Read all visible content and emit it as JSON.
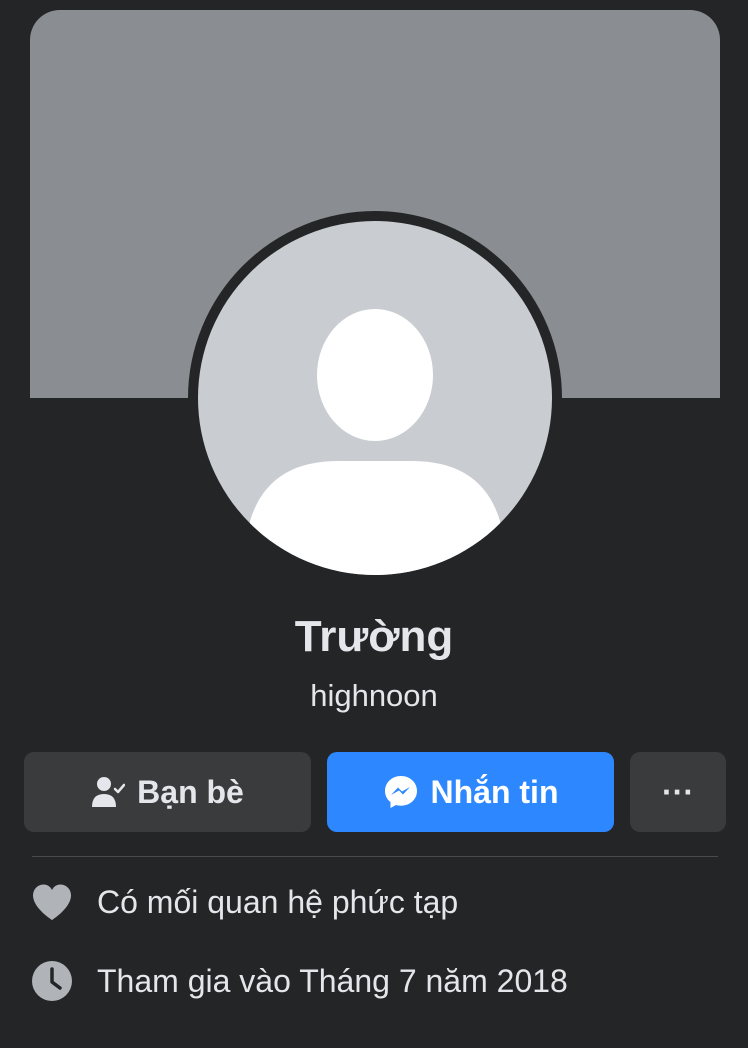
{
  "profile": {
    "name": "Trường",
    "username": "highnoon"
  },
  "actions": {
    "friends_label": "Bạn bè",
    "message_label": "Nhắn tin",
    "more_label": "···"
  },
  "details": [
    {
      "icon": "heart-icon",
      "text": "Có mối quan hệ phức tạp"
    },
    {
      "icon": "clock-icon",
      "text": "Tham gia vào Tháng 7 năm 2018"
    }
  ],
  "colors": {
    "background": "#242526",
    "cover": "#8a8d91",
    "avatar_bg": "#c9ccd1",
    "button_secondary": "#3a3b3c",
    "button_primary": "#2d88ff",
    "text_primary": "#e4e6eb"
  }
}
